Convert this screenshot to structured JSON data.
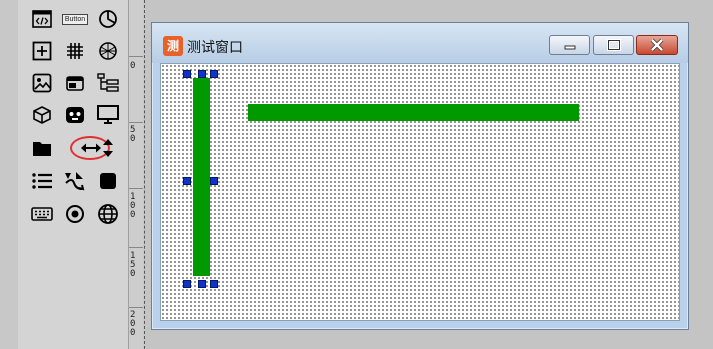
{
  "toolbox": {
    "button_caption": "Button",
    "tools": [
      "html-tag-icon",
      "button-icon",
      "pie-chart-icon",
      "plus-box-icon",
      "grid-icon",
      "sphere-icon",
      "image-icon",
      "window-icon",
      "tree-icon",
      "cube-icon",
      "robot-face-icon",
      "monitor-icon",
      "folder-icon",
      "horizontal-resize-icon",
      "vertical-resize-icon",
      "list-icon",
      "shapes-icon",
      "square-icon",
      "keyboard-icon",
      "radio-icon",
      "globe-icon"
    ],
    "highlighted_tool": "horizontal-resize-icon",
    "highlight_color": "#e03030"
  },
  "ruler": {
    "labels": [
      "0",
      "50",
      "100",
      "150",
      "200"
    ]
  },
  "window": {
    "title": "测试窗口",
    "icon_char": "测",
    "icon_color": "#e8602a"
  },
  "controls": {
    "bar_color": "#009900",
    "handle_color": "#1133cc",
    "selected": "vertical-bar"
  }
}
